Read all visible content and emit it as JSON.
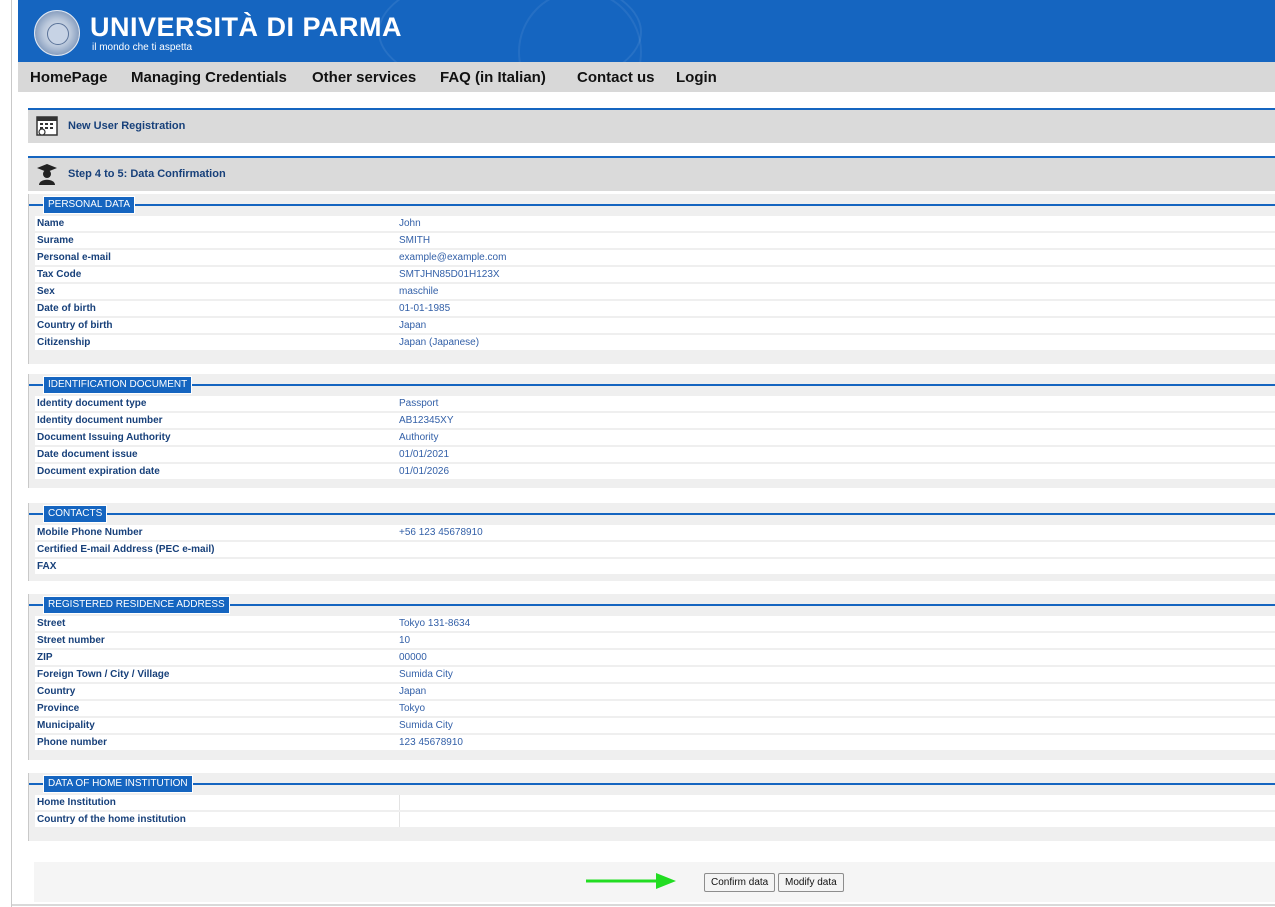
{
  "brand": {
    "title": "UNIVERSITÀ DI PARMA",
    "subtitle": "il mondo che ti aspetta"
  },
  "nav": {
    "items": [
      "HomePage",
      "Managing Credentials",
      "Other services",
      "FAQ (in Italian)",
      "Contact us",
      "Login"
    ]
  },
  "page_title": "New User Registration",
  "step_title": "Step 4 to 5: Data Confirmation",
  "sections": {
    "personal": {
      "legend": "PERSONAL DATA",
      "rows": [
        {
          "k": "Name",
          "v": "John"
        },
        {
          "k": "Surame",
          "v": "SMITH"
        },
        {
          "k": "Personal e-mail",
          "v": "example@example.com"
        },
        {
          "k": "Tax Code",
          "v": "SMTJHN85D01H123X"
        },
        {
          "k": "Sex",
          "v": "maschile"
        },
        {
          "k": "Date of birth",
          "v": "01-01-1985"
        },
        {
          "k": "Country of birth",
          "v": "Japan"
        },
        {
          "k": "Citizenship",
          "v": "Japan (Japanese)"
        }
      ]
    },
    "identification": {
      "legend": "IDENTIFICATION DOCUMENT",
      "rows": [
        {
          "k": "Identity document type",
          "v": "Passport"
        },
        {
          "k": "Identity document number",
          "v": "AB12345XY"
        },
        {
          "k": "Document Issuing Authority",
          "v": "Authority"
        },
        {
          "k": "Date document issue",
          "v": "01/01/2021"
        },
        {
          "k": "Document expiration date",
          "v": "01/01/2026"
        }
      ]
    },
    "contacts": {
      "legend": "CONTACTS",
      "rows": [
        {
          "k": "Mobile Phone Number",
          "v": "+56 123 45678910"
        },
        {
          "k": "Certified E-mail Address (PEC e-mail)",
          "v": ""
        },
        {
          "k": "FAX",
          "v": ""
        }
      ]
    },
    "residence": {
      "legend": "REGISTERED RESIDENCE ADDRESS",
      "rows": [
        {
          "k": "Street",
          "v": "Tokyo 131-8634"
        },
        {
          "k": "Street number",
          "v": "10"
        },
        {
          "k": "ZIP",
          "v": "00000"
        },
        {
          "k": "Foreign Town / City / Village",
          "v": "Sumida City"
        },
        {
          "k": "Country",
          "v": "Japan"
        },
        {
          "k": "Province",
          "v": "Tokyo"
        },
        {
          "k": "Municipality",
          "v": "Sumida City"
        },
        {
          "k": "Phone number",
          "v": "123 45678910"
        }
      ]
    },
    "home_institution": {
      "legend": "DATA OF HOME INSTITUTION",
      "rows": [
        {
          "k": "Home Institution",
          "v": ""
        },
        {
          "k": "Country of the home institution",
          "v": ""
        }
      ]
    }
  },
  "buttons": {
    "confirm": "Confirm data",
    "modify": "Modify data"
  },
  "colors": {
    "brand_blue": "#1565c0",
    "arrow_green": "#22dd22"
  }
}
